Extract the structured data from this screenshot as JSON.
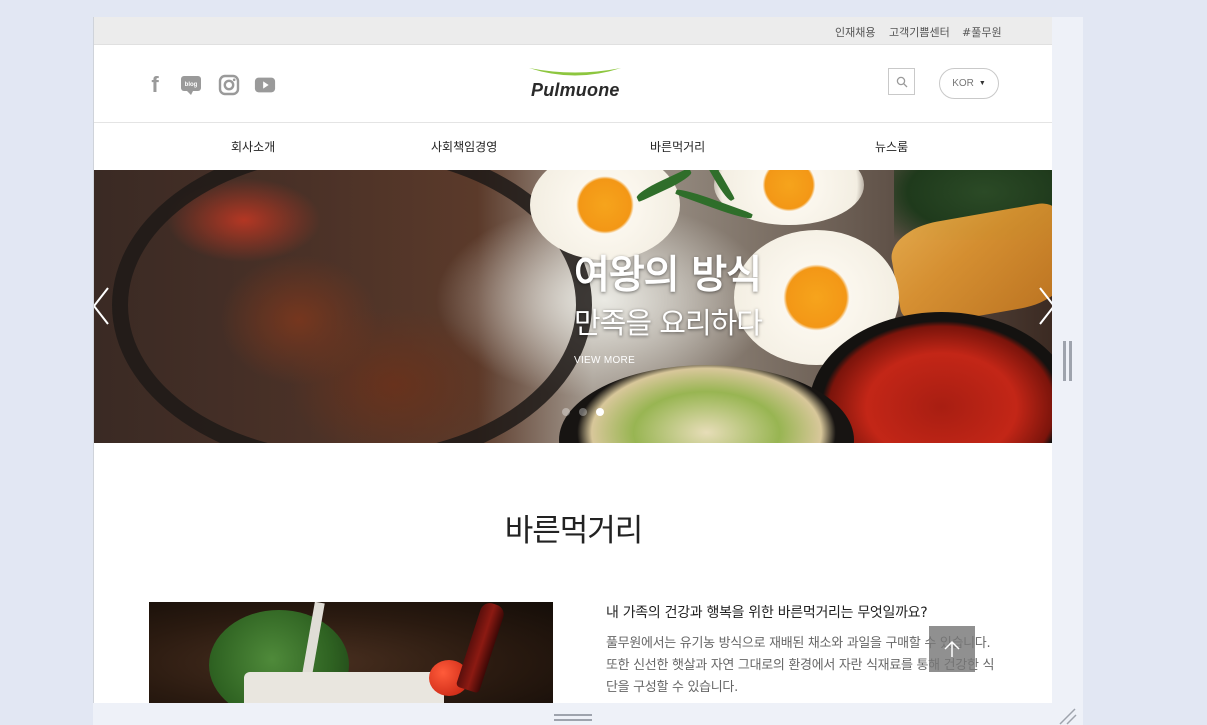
{
  "utility_links": [
    "인재채용",
    "고객기쁨센터",
    "#풀무원"
  ],
  "header": {
    "social_icons": [
      "facebook-icon",
      "blog-icon",
      "instagram-icon",
      "youtube-icon"
    ],
    "social_f": "f",
    "blog_text": "blog",
    "logo_text": "Pulmuone",
    "lang_label": "KOR",
    "lang_caret": "▼"
  },
  "nav": {
    "items": [
      "회사소개",
      "사회책임경영",
      "바른먹거리",
      "뉴스룸"
    ]
  },
  "hero": {
    "title": "여왕의 방식",
    "subtitle": "만족을 요리하다",
    "cta": "VIEW MORE",
    "slide_count": 3,
    "active_slide_index": 2
  },
  "section": {
    "title": "바른먹거리",
    "question": "내 가족의 건강과 행복을 위한 바른먹거리는 무엇일까요?",
    "body": "풀무원에서는 유기농 방식으로 재배된 채소와 과일을 구매할 수 있습니다. 또한 신선한 햇살과 자연 그대로의 환경에서 자란 식재료를 통해 건강한 식단을 구성할 수 있습니다."
  },
  "colors": {
    "brand_green": "#8dc63f",
    "text_dark": "#222222",
    "text_muted": "#666666",
    "utility_bg": "#ececec",
    "page_bg": "#e2e7f3"
  }
}
